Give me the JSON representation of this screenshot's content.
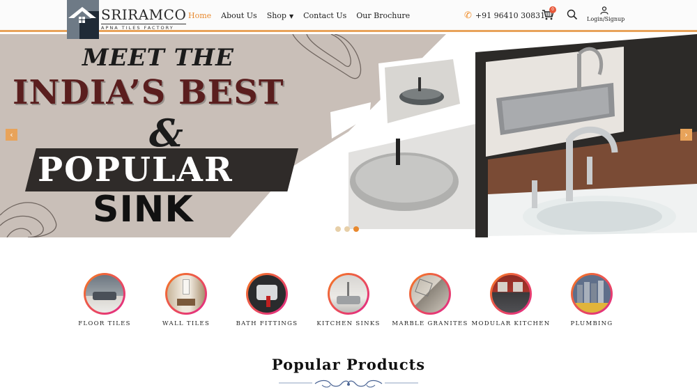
{
  "brand": {
    "name": "SRIRAMCO",
    "tagline": "APNA TILES FACTORY"
  },
  "nav": {
    "items": [
      {
        "label": "Home",
        "active": true
      },
      {
        "label": "About Us"
      },
      {
        "label": "Shop",
        "has_dropdown": true
      },
      {
        "label": "Contact Us"
      },
      {
        "label": "Our Brochure"
      }
    ]
  },
  "header": {
    "phone": "+91 96410 30831",
    "cart_count": "0",
    "login_label": "Login/Signup",
    "icons": [
      "phone-icon",
      "cart-icon",
      "search-icon",
      "user-icon"
    ]
  },
  "hero": {
    "line1": "MEET THE",
    "line2": "INDIA’S BEST",
    "line3": "&",
    "line4": "POPULAR",
    "line5": "SINK",
    "prev_arrow": "‹",
    "next_arrow": "›",
    "slide_count": 3,
    "active_slide": 3
  },
  "categories": [
    {
      "label": "FLOOR TILES"
    },
    {
      "label": "WALL TILES"
    },
    {
      "label": "BATH FITTINGS"
    },
    {
      "label": "KITCHEN SINKS"
    },
    {
      "label": "MARBLE GRANITES"
    },
    {
      "label": "MODULAR KITCHEN"
    },
    {
      "label": "PLUMBING"
    }
  ],
  "section": {
    "title": "Popular  Products"
  },
  "colors": {
    "accent": "#e8892f",
    "header_border": "#e8a35a",
    "badge": "#e8583a"
  }
}
